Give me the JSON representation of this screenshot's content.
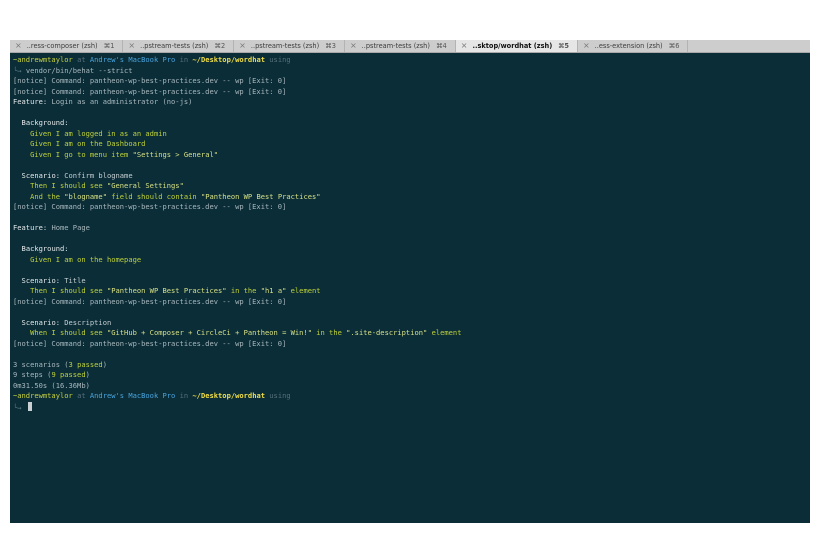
{
  "tabs": [
    {
      "close": "×",
      "label": "..ress-composer (zsh)",
      "shortcut": "⌘1",
      "active": false
    },
    {
      "close": "×",
      "label": "..pstream-tests (zsh)",
      "shortcut": "⌘2",
      "active": false
    },
    {
      "close": "×",
      "label": "..pstream-tests (zsh)",
      "shortcut": "⌘3",
      "active": false
    },
    {
      "close": "×",
      "label": "..pstream-tests (zsh)",
      "shortcut": "⌘4",
      "active": false
    },
    {
      "close": "×",
      "label": "..sktop/wordhat (zsh)",
      "shortcut": "⌘5",
      "active": true
    },
    {
      "close": "×",
      "label": "..ess-extension (zsh)",
      "shortcut": "⌘6",
      "active": false
    }
  ],
  "prompt": {
    "user": "~andrewmtaylor",
    "at": " at ",
    "host": "Andrew's MacBook Pro",
    "in": " in ",
    "path": "~/Desktop/wordhat",
    "using": " using",
    "arrow": "╰→ "
  },
  "command": "vendor/bin/behat --strict",
  "notice": "[notice] Command: pantheon-wp-best-practices.dev -- wp [Exit: 0]",
  "features": {
    "feature_kw": "Feature:",
    "background_kw": "Background:",
    "scenario_kw": "Scenario:",
    "f1": "Login as an administrator (no-js)",
    "f1_bg_steps": [
      {
        "pre": "Given I am logged in as an admin",
        "arg": "",
        "post": ""
      },
      {
        "pre": "Given I am on the Dashboard",
        "arg": "",
        "post": ""
      },
      {
        "pre": "Given I go to menu item ",
        "arg": "\"Settings > General\"",
        "post": ""
      }
    ],
    "f1_s1": "Confirm blogname",
    "f1_s1_steps": [
      {
        "pre": "Then I should see ",
        "arg": "\"General Settings\"",
        "post": ""
      },
      {
        "pre": "And the ",
        "arg": "\"blogname\"",
        "post": " field should contain ",
        "arg2": "\"Pantheon WP Best Practices\""
      }
    ],
    "f2": "Home Page",
    "f2_bg_steps": [
      {
        "pre": "Given I am on the homepage",
        "arg": "",
        "post": ""
      }
    ],
    "f2_s1": "Title",
    "f2_s1_steps": [
      {
        "pre": "Then I should see ",
        "arg": "\"Pantheon WP Best Practices\"",
        "post": " in the ",
        "arg2": "\"h1 a\"",
        "post2": " element"
      }
    ],
    "f2_s2": "Description",
    "f2_s2_steps": [
      {
        "pre": "When I should see ",
        "arg": "\"GitHub + Composer + CircleCi + Pantheon = Win!\"",
        "post": " in the ",
        "arg2": "\".site-description\"",
        "post2": " element"
      }
    ]
  },
  "summary": {
    "scenarios_pre": "3 scenarios (",
    "scenarios_pass": "3 passed",
    "scenarios_post": ")",
    "steps_pre": "9 steps (",
    "steps_pass": "9 passed",
    "steps_post": ")",
    "time": "0m31.50s (16.36Mb)"
  },
  "colors": {
    "background": "#0b2d38",
    "step": "#bfd23a",
    "host": "#49a4dc",
    "path": "#f2df47"
  }
}
